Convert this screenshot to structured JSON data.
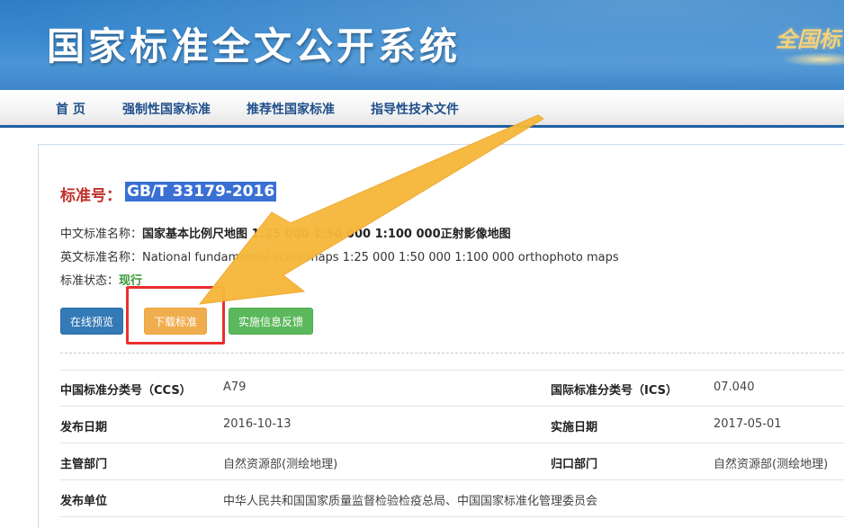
{
  "header": {
    "title": "国家标准全文公开系统",
    "logo_text": "全国标"
  },
  "nav": {
    "items": [
      "首 页",
      "强制性国家标准",
      "推荐性国家标准",
      "指导性技术文件"
    ]
  },
  "standard": {
    "label": "标准号：",
    "number": "GB/T 33179-2016",
    "cn_name_label": "中文标准名称：",
    "cn_name_value": "国家基本比例尺地图 1:25 000 1:50 000 1:100 000正射影像地图",
    "en_name_label": "英文标准名称：",
    "en_name_value": "National fundamental scale maps 1:25 000 1:50 000 1:100 000 orthophoto maps",
    "status_label": "标准状态：",
    "status_value": "现行"
  },
  "buttons": {
    "preview": "在线预览",
    "download": "下载标准",
    "feedback": "实施信息反馈"
  },
  "details": {
    "rows": [
      {
        "k1": "中国标准分类号（CCS）",
        "v1": "A79",
        "k2": "国际标准分类号（ICS）",
        "v2": "07.040"
      },
      {
        "k1": "发布日期",
        "v1": "2016-10-13",
        "k2": "实施日期",
        "v2": "2017-05-01"
      },
      {
        "k1": "主管部门",
        "v1": "自然资源部(测绘地理)",
        "k2": "归口部门",
        "v2": "自然资源部(测绘地理)"
      },
      {
        "k1": "发布单位",
        "v1": "中华人民共和国国家质量监督检验检疫总局、中国国家标准化管理委员会",
        "k2": "",
        "v2": ""
      }
    ]
  },
  "colors": {
    "arrow": "#f6b637",
    "highlight": "#e8302f",
    "nav_text": "#1f4f8a"
  }
}
